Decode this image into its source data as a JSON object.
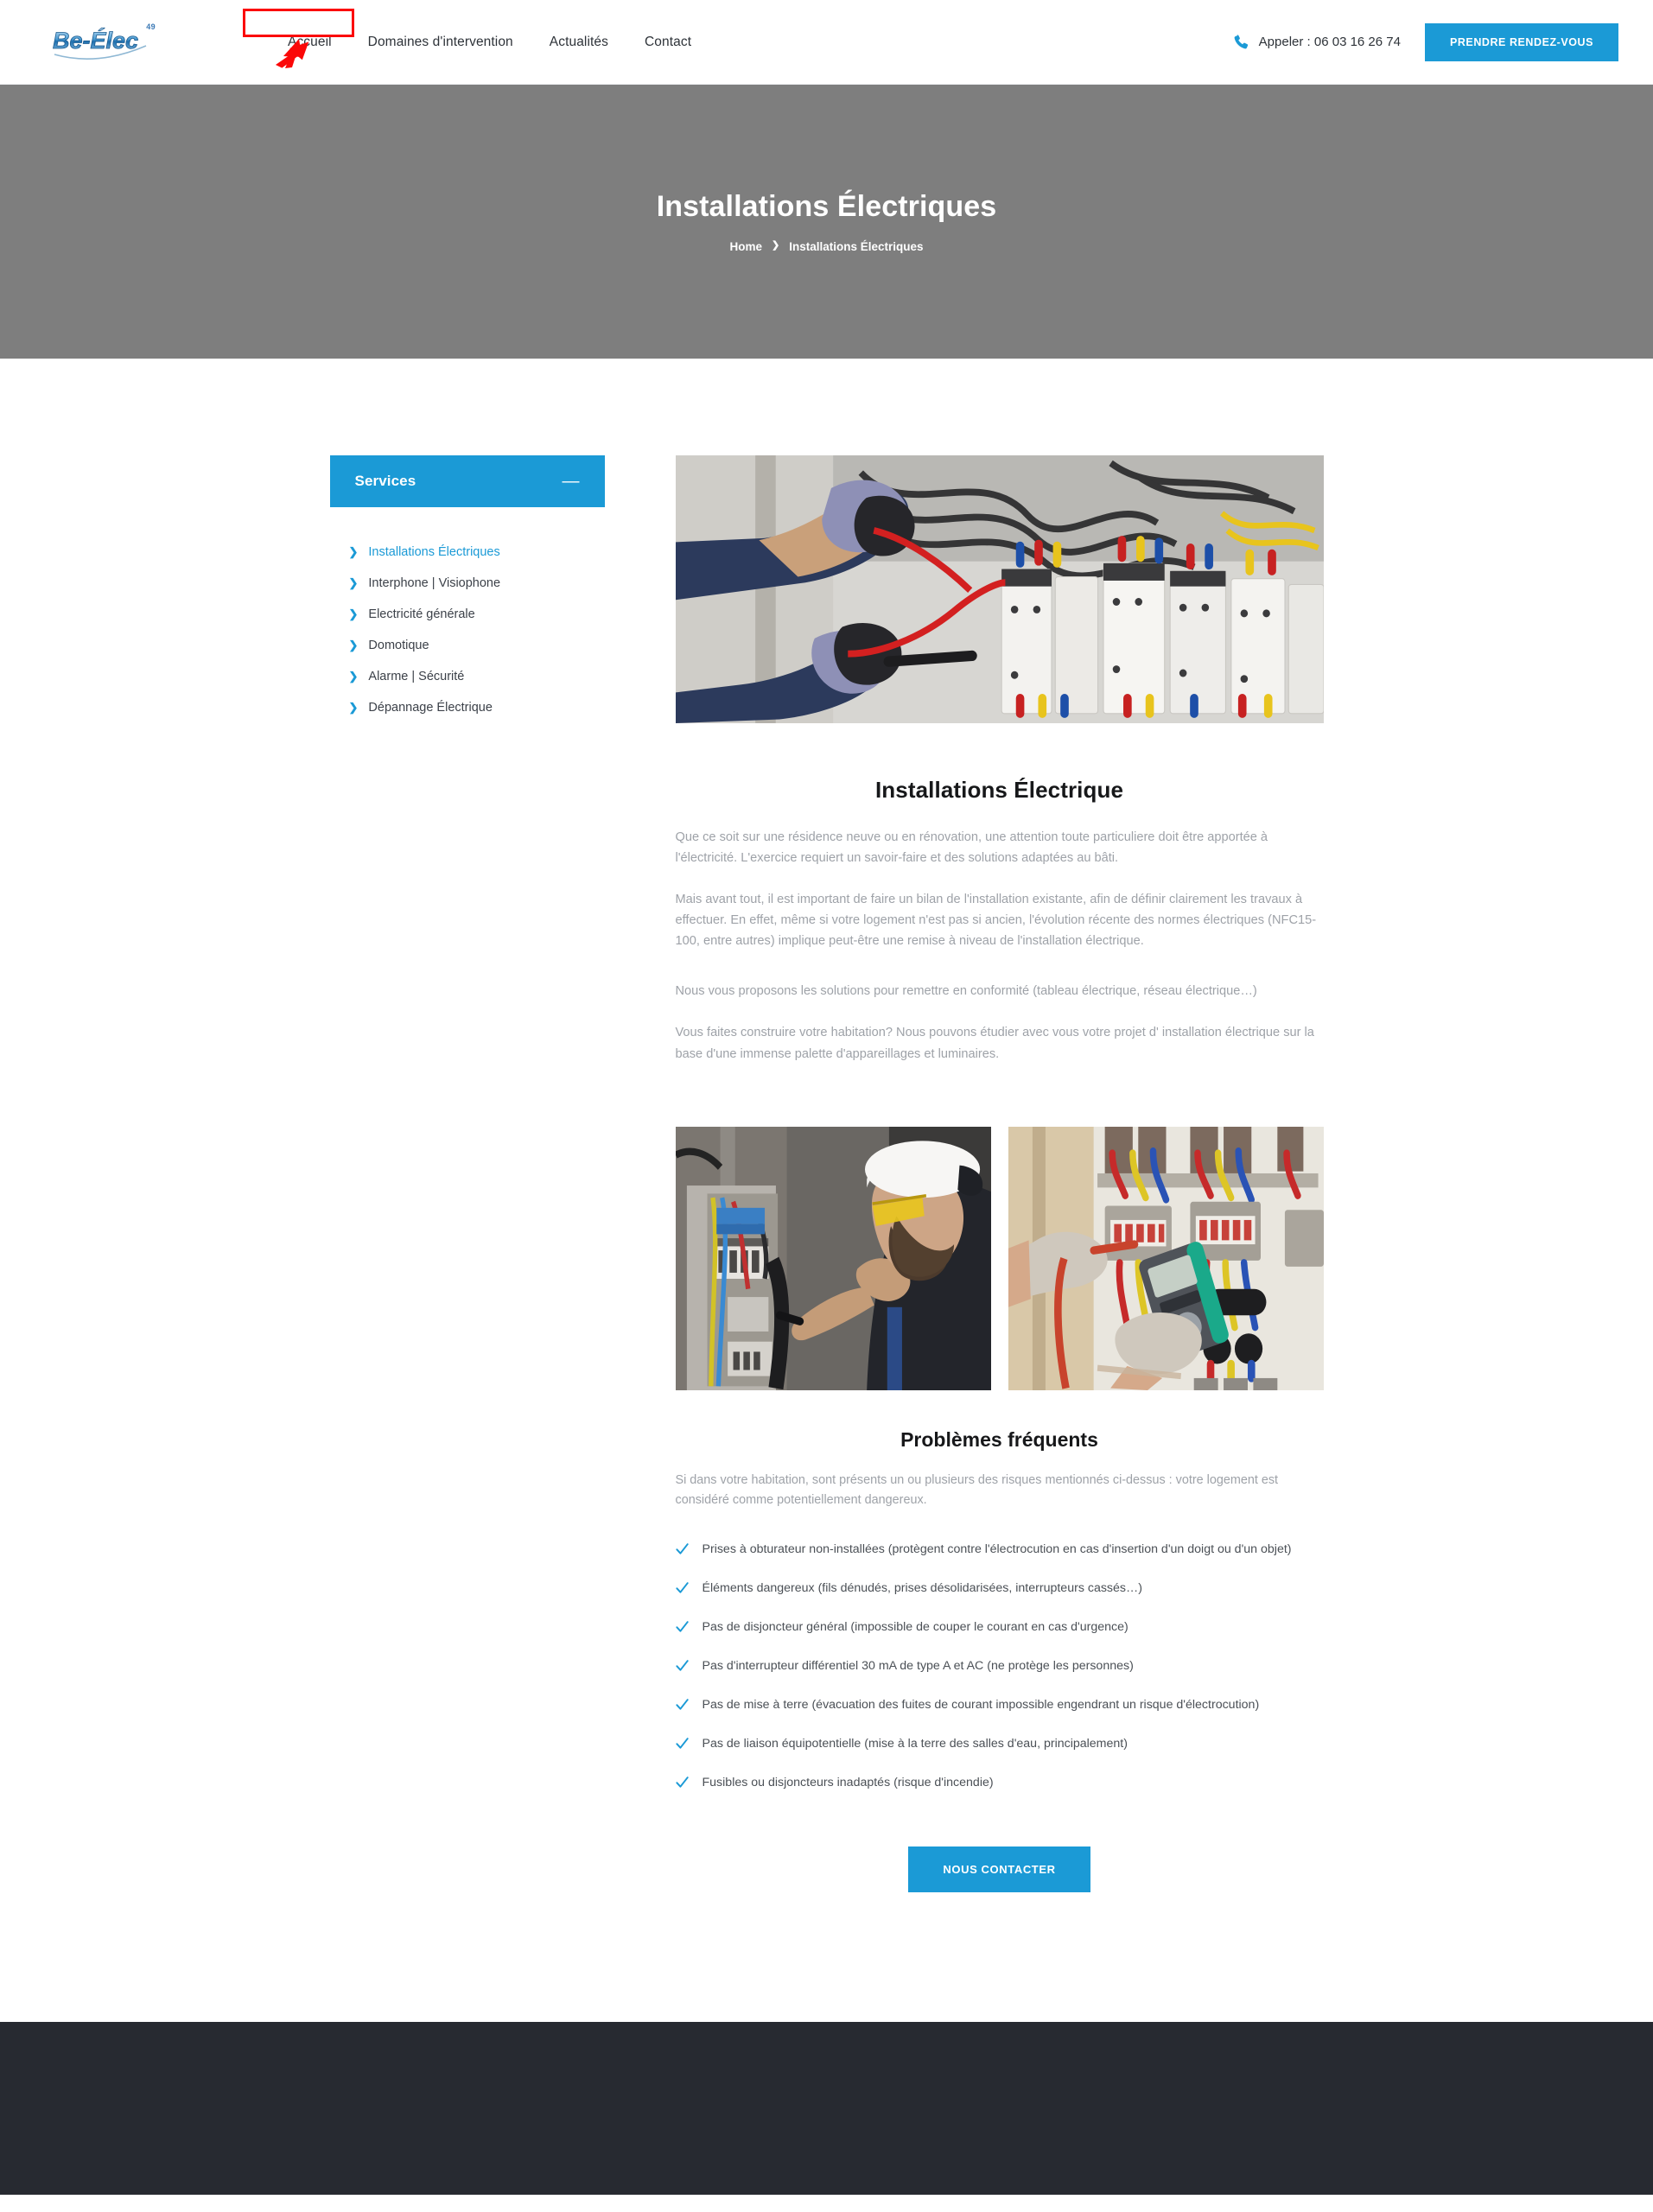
{
  "header": {
    "logo": {
      "name": "Be-Élec",
      "superscript": "49"
    },
    "nav": [
      {
        "label": "Accueil",
        "name": "nav-accueil"
      },
      {
        "label": "Domaines d'intervention",
        "name": "nav-domaines-intervention"
      },
      {
        "label": "Actualités",
        "name": "nav-actualites"
      },
      {
        "label": "Contact",
        "name": "nav-contact"
      }
    ],
    "phone": {
      "icon": "phone-icon",
      "text": "Appeler : 06 03 16 26 74"
    },
    "appointment_button": "PRENDRE RENDEZ-VOUS"
  },
  "annotation": {
    "highlight_target": "Domaines d'intervention",
    "color": "#fb0808",
    "arrow": "up-right-arrow"
  },
  "hero": {
    "title": "Installations Électriques",
    "background_color": "#7e7e7e",
    "breadcrumb": {
      "home": "Home",
      "separator": "❯",
      "current": "Installations Électriques"
    }
  },
  "sidebar": {
    "title": "Services",
    "toggle_icon": "minus-icon",
    "toggle_glyph": "—",
    "items": [
      {
        "label": "Installations Électriques",
        "active": true
      },
      {
        "label": "Interphone | Visiophone",
        "active": false
      },
      {
        "label": "Electricité générale",
        "active": false
      },
      {
        "label": "Domotique",
        "active": false
      },
      {
        "label": "Alarme | Sécurité",
        "active": false
      },
      {
        "label": "Dépannage Électrique",
        "active": false
      }
    ],
    "chevron_glyph": "❯"
  },
  "main": {
    "hero_image_alt": "Électricien gantée câblant un tableau électrique industriel",
    "title": "Installations Électrique",
    "paragraphs": [
      "Que ce soit sur une résidence neuve ou en rénovation, une attention toute particuliere doit être apportée à l'électricité. L'exercice requiert un savoir-faire et des solutions adaptées au bâti.",
      "Mais avant tout, il est important de faire un bilan de l'installation existante, afin de définir clairement les travaux à effectuer. En effet, même si votre logement n'est pas si ancien, l'évolution récente des normes électriques (NFC15-100, entre autres) implique peut-être une remise à niveau de l'installation électrique.",
      "Nous vous proposons les solutions pour remettre en conformité (tableau électrique, réseau électrique…)",
      "Vous faites construire votre habitation? Nous pouvons étudier avec vous votre projet d' installation électrique sur la base d'une immense palette d'appareillages et luminaires."
    ],
    "gallery": [
      {
        "alt": "Électricien avec casque blanc et lunettes jaunes travaillant sur un tableau"
      },
      {
        "alt": "Mains gantées mesurant une armoire électrique avec un multimètre"
      }
    ],
    "problems": {
      "title": "Problèmes fréquents",
      "intro": "Si dans votre habitation, sont présents un ou plusieurs des risques mentionnés ci-dessus : votre logement est considéré comme potentiellement dangereux.",
      "check_icon": "check-icon",
      "items": [
        "Prises à obturateur non-installées (protègent contre l'électrocution en cas d'insertion d'un doigt ou d'un objet)",
        "Éléments dangereux (fils dénudés, prises désolidarisées, interrupteurs cassés…)",
        "Pas de disjoncteur général (impossible de couper le courant en cas d'urgence)",
        "Pas d'interrupteur différentiel 30 mA de type A et AC (ne protège les personnes)",
        "Pas de mise à terre (évacuation des fuites de courant impossible engendrant un risque d'électrocution)",
        "Pas de liaison équipotentielle (mise à la terre des salles d'eau, principalement)",
        "Fusibles ou disjoncteurs inadaptés (risque d'incendie)"
      ]
    },
    "cta_button": "NOUS CONTACTER"
  },
  "colors": {
    "accent": "#1b9ad6",
    "hero_bg": "#7e7e7e",
    "footer_bg": "#272a31",
    "annotation_red": "#fb0808",
    "body_text": "#9ea2a8"
  }
}
